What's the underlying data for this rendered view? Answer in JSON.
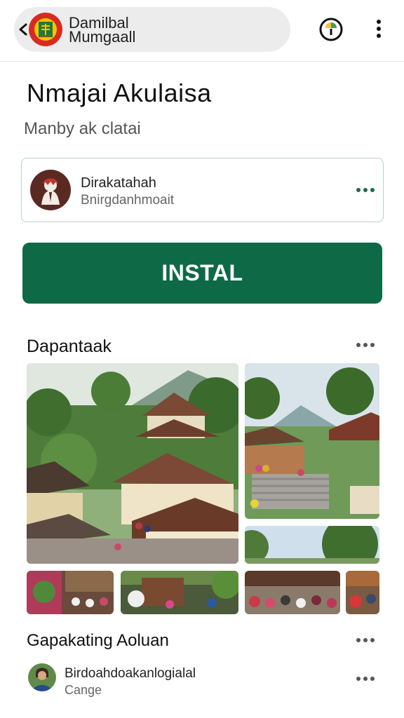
{
  "header": {
    "app_name_line1": "Damilbal",
    "app_name_line2": "Mumgaall",
    "back_icon": "back-arrow-icon",
    "info_icon": "info-icon",
    "menu_icon": "more-vertical-icon"
  },
  "app": {
    "title": "Nmajai Akulaisa",
    "subtitle": "Manby ak clatai"
  },
  "developer": {
    "name": "Dirakatahah",
    "subtitle": "Bnirgdanhmoait"
  },
  "install_label": "INSTAL",
  "screenshots_section": {
    "title": "Dapantaak"
  },
  "reviews_section": {
    "title": "Gapakating Aoluan",
    "reviewer_name": "Birdoahdoakanlogialal",
    "reviewer_sub": "Cange"
  },
  "colors": {
    "accent": "#0e6a46",
    "card_border": "#b7d4c6",
    "pill_bg": "#ececec"
  }
}
